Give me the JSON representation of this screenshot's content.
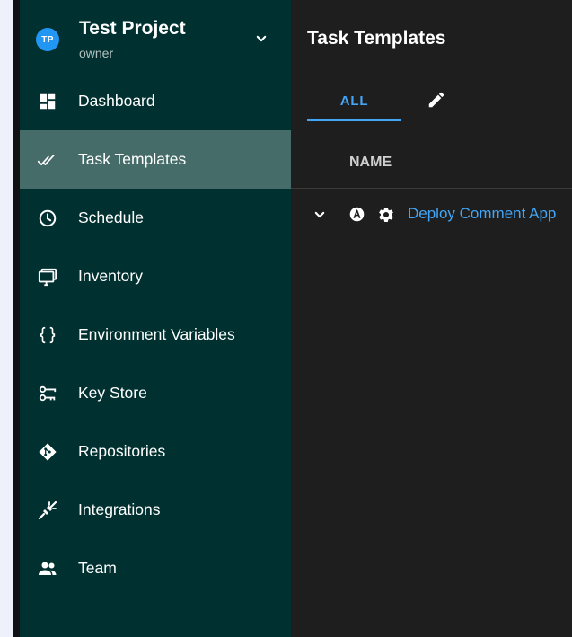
{
  "project": {
    "initials": "TP",
    "name": "Test Project",
    "role": "owner"
  },
  "sidebar": {
    "items": [
      {
        "label": "Dashboard",
        "icon": "dashboard-icon"
      },
      {
        "label": "Task Templates",
        "icon": "double-check-icon",
        "active": true
      },
      {
        "label": "Schedule",
        "icon": "clock-icon"
      },
      {
        "label": "Inventory",
        "icon": "monitor-icon"
      },
      {
        "label": "Environment Variables",
        "icon": "code-braces-icon"
      },
      {
        "label": "Key Store",
        "icon": "key-icon"
      },
      {
        "label": "Repositories",
        "icon": "git-icon"
      },
      {
        "label": "Integrations",
        "icon": "connection-icon"
      },
      {
        "label": "Team",
        "icon": "team-icon"
      }
    ]
  },
  "main": {
    "title": "Task Templates",
    "tabs": {
      "all_label": "ALL",
      "edit_icon": "pencil-icon"
    },
    "table": {
      "column_name": "NAME",
      "rows": [
        {
          "name": "Deploy Comment App",
          "icons": [
            "chevron-down-icon",
            "alpha-a-circle-icon",
            "gear-icon"
          ]
        }
      ]
    }
  },
  "colors": {
    "sidebar_bg": "#00302f",
    "sidebar_active_bg": "#456c69",
    "main_bg": "#1e1e1e",
    "accent": "#42a5f5",
    "avatar_bg": "#2196f3"
  }
}
